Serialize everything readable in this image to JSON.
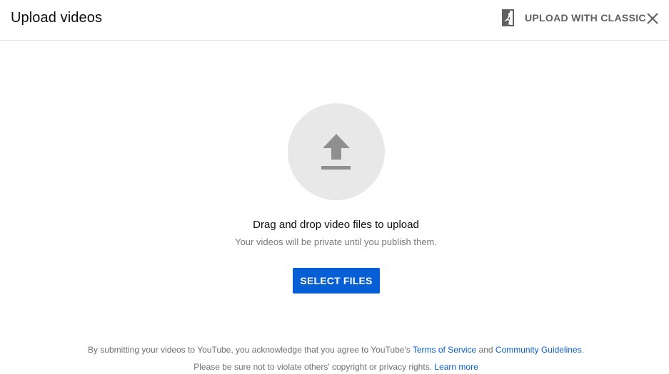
{
  "header": {
    "title": "Upload videos",
    "classic_label": "UPLOAD WITH CLASSIC",
    "classic_icon": "exit-door-icon",
    "close_icon": "close-icon"
  },
  "dropzone": {
    "icon": "upload-arrow-icon",
    "drag_text": "Drag and drop video files to upload",
    "private_text": "Your videos will be private until you publish them."
  },
  "select_button": {
    "label": "SELECT FILES",
    "color": "#065fd4"
  },
  "footer": {
    "line1_prefix": "By submitting your videos to YouTube, you acknowledge that you agree to YouTube's",
    "terms_link": "Terms of Service",
    "line1_and": "and",
    "guidelines_link": "Community Guidelines",
    "line1_suffix": ".",
    "line2_prefix": "Please be sure not to violate others' copyright or privacy rights.",
    "learn_more_link": "Learn more"
  }
}
